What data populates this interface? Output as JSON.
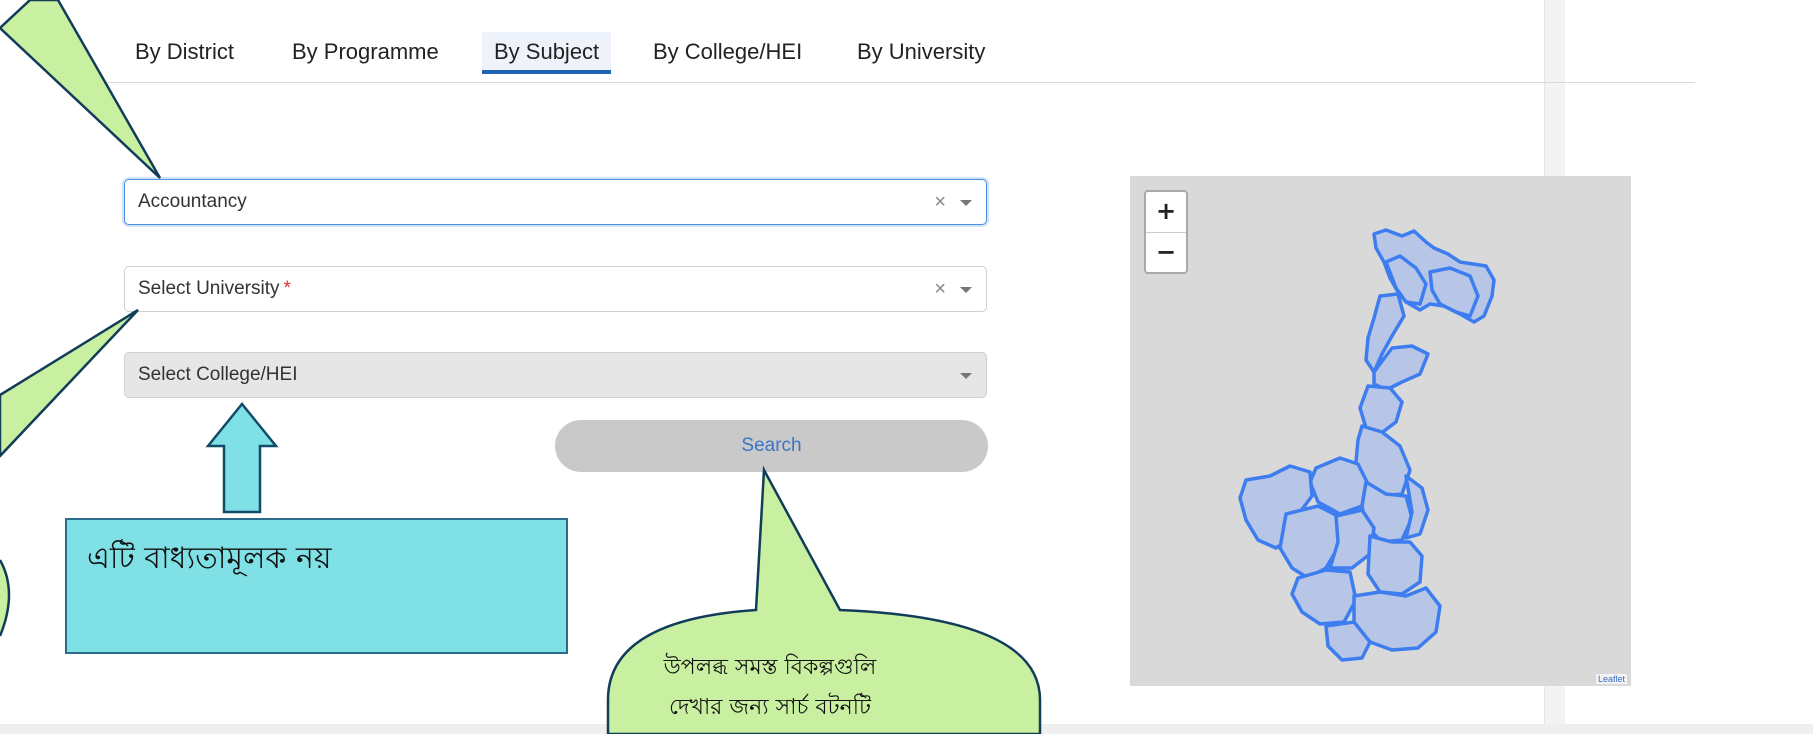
{
  "tabs": [
    {
      "label": "By District"
    },
    {
      "label": "By Programme"
    },
    {
      "label": "By Subject"
    },
    {
      "label": "By College/HEI"
    },
    {
      "label": "By University"
    }
  ],
  "active_tab": "By Subject",
  "form": {
    "subject_value": "Accountancy",
    "university_placeholder": "Select University",
    "university_required_mark": "*",
    "college_placeholder": "Select College/HEI",
    "clear_glyph": "×",
    "search_label": "Search"
  },
  "map": {
    "zoom_in": "+",
    "zoom_out": "−",
    "attribution": "Leaflet",
    "region_fill": "#b7c6e6",
    "region_stroke": "#3d7df0"
  },
  "callouts": {
    "college_note": "এটি বাধ্যতামূলক নয়",
    "search_note_line1": "উপলব্ধ সমস্ত বিকল্পগুলি",
    "search_note_line2": "দেখার জন্য সার্চ  বটনটি"
  }
}
